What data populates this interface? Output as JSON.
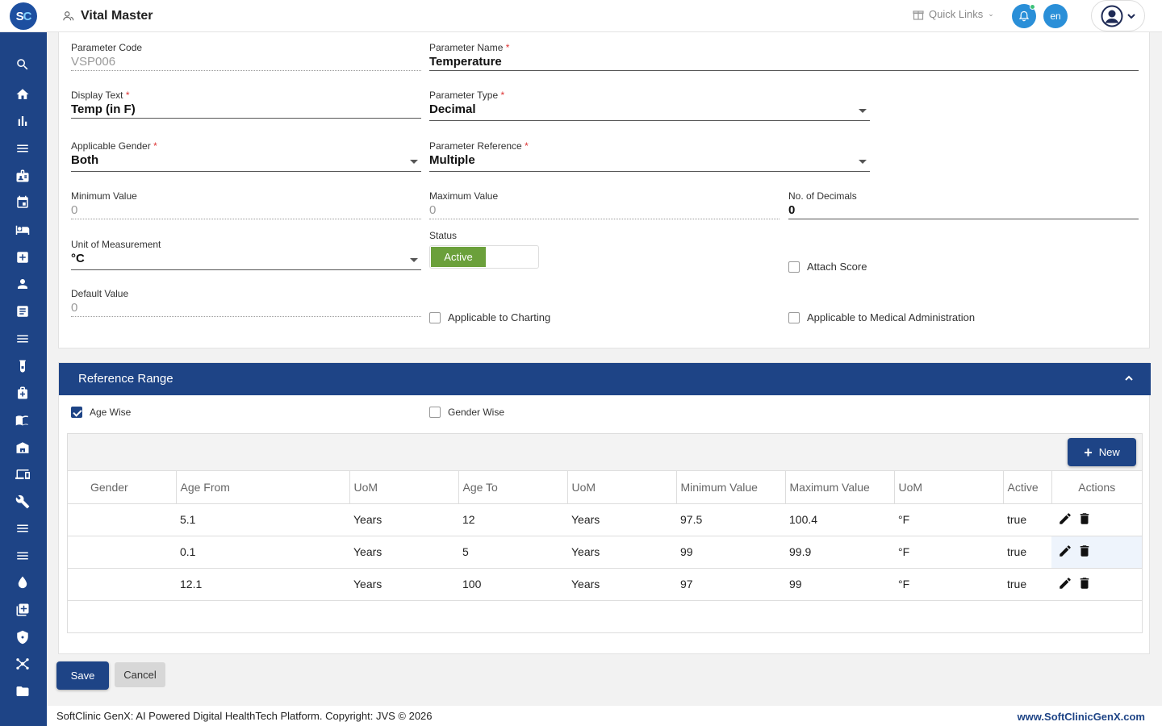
{
  "app": {
    "logo_text_s": "S",
    "logo_text_c": "C",
    "page_title": "Vital Master",
    "quick_links": "Quick Links",
    "lang": "en"
  },
  "sidebar": {
    "items": [
      "search-icon",
      "home-icon",
      "bar-chart-icon",
      "list-icon",
      "badge-icon",
      "calendar-icon",
      "bed-icon",
      "medical-cross-icon",
      "person-icon",
      "document-icon",
      "list-icon",
      "lab-icon",
      "pharmacy-icon",
      "book-icon",
      "store-icon",
      "devices-icon",
      "wrench-icon",
      "list-icon",
      "list-icon",
      "drop-icon",
      "add-box-icon",
      "shield-icon",
      "network-icon",
      "folder-icon"
    ]
  },
  "form": {
    "parameter_code": {
      "label": "Parameter Code",
      "value": "VSP006"
    },
    "parameter_name": {
      "label": "Parameter Name",
      "value": "Temperature"
    },
    "display_text": {
      "label": "Display Text",
      "value": "Temp (in F)"
    },
    "parameter_type": {
      "label": "Parameter Type",
      "value": "Decimal"
    },
    "applicable_gender": {
      "label": "Applicable Gender",
      "value": "Both"
    },
    "parameter_reference": {
      "label": "Parameter Reference",
      "value": "Multiple"
    },
    "minimum_value": {
      "label": "Minimum Value",
      "value": "0"
    },
    "maximum_value": {
      "label": "Maximum Value",
      "value": "0"
    },
    "no_of_decimals": {
      "label": "No. of Decimals",
      "value": "0"
    },
    "unit_of_measurement": {
      "label": "Unit of Measurement",
      "value": "°C"
    },
    "status": {
      "label": "Status",
      "value": "Active"
    },
    "attach_score": {
      "label": "Attach Score",
      "checked": false
    },
    "default_value": {
      "label": "Default Value",
      "value": "0"
    },
    "applicable_to_charting": {
      "label": "Applicable to Charting",
      "checked": false
    },
    "applicable_to_medical_administration": {
      "label": "Applicable to Medical Administration",
      "checked": false
    },
    "required_mark": "*"
  },
  "reference_range": {
    "title": "Reference Range",
    "age_wise": {
      "label": "Age Wise",
      "checked": true
    },
    "gender_wise": {
      "label": "Gender Wise",
      "checked": false
    },
    "new_button": "New",
    "columns": [
      "Gender",
      "Age From",
      "UoM",
      "Age To",
      "UoM",
      "Minimum Value",
      "Maximum Value",
      "UoM",
      "Active",
      "Actions"
    ],
    "rows": [
      {
        "gender": "",
        "age_from": "5.1",
        "uom1": "Years",
        "age_to": "12",
        "uom2": "Years",
        "min": "97.5",
        "max": "100.4",
        "uom3": "°F",
        "active": "true"
      },
      {
        "gender": "",
        "age_from": "0.1",
        "uom1": "Years",
        "age_to": "5",
        "uom2": "Years",
        "min": "99",
        "max": "99.9",
        "uom3": "°F",
        "active": "true"
      },
      {
        "gender": "",
        "age_from": "12.1",
        "uom1": "Years",
        "age_to": "100",
        "uom2": "Years",
        "min": "97",
        "max": "99",
        "uom3": "°F",
        "active": "true"
      }
    ]
  },
  "actions": {
    "save": "Save",
    "cancel": "Cancel"
  },
  "footer": {
    "text": "SoftClinic GenX: AI Powered Digital HealthTech Platform. Copyright: JVS © 2026",
    "link": "www.SoftClinicGenX.com"
  },
  "colors": {
    "brand": "#1e4486",
    "active_green": "#6ba03b",
    "accent_blue": "#2a8fd8"
  }
}
